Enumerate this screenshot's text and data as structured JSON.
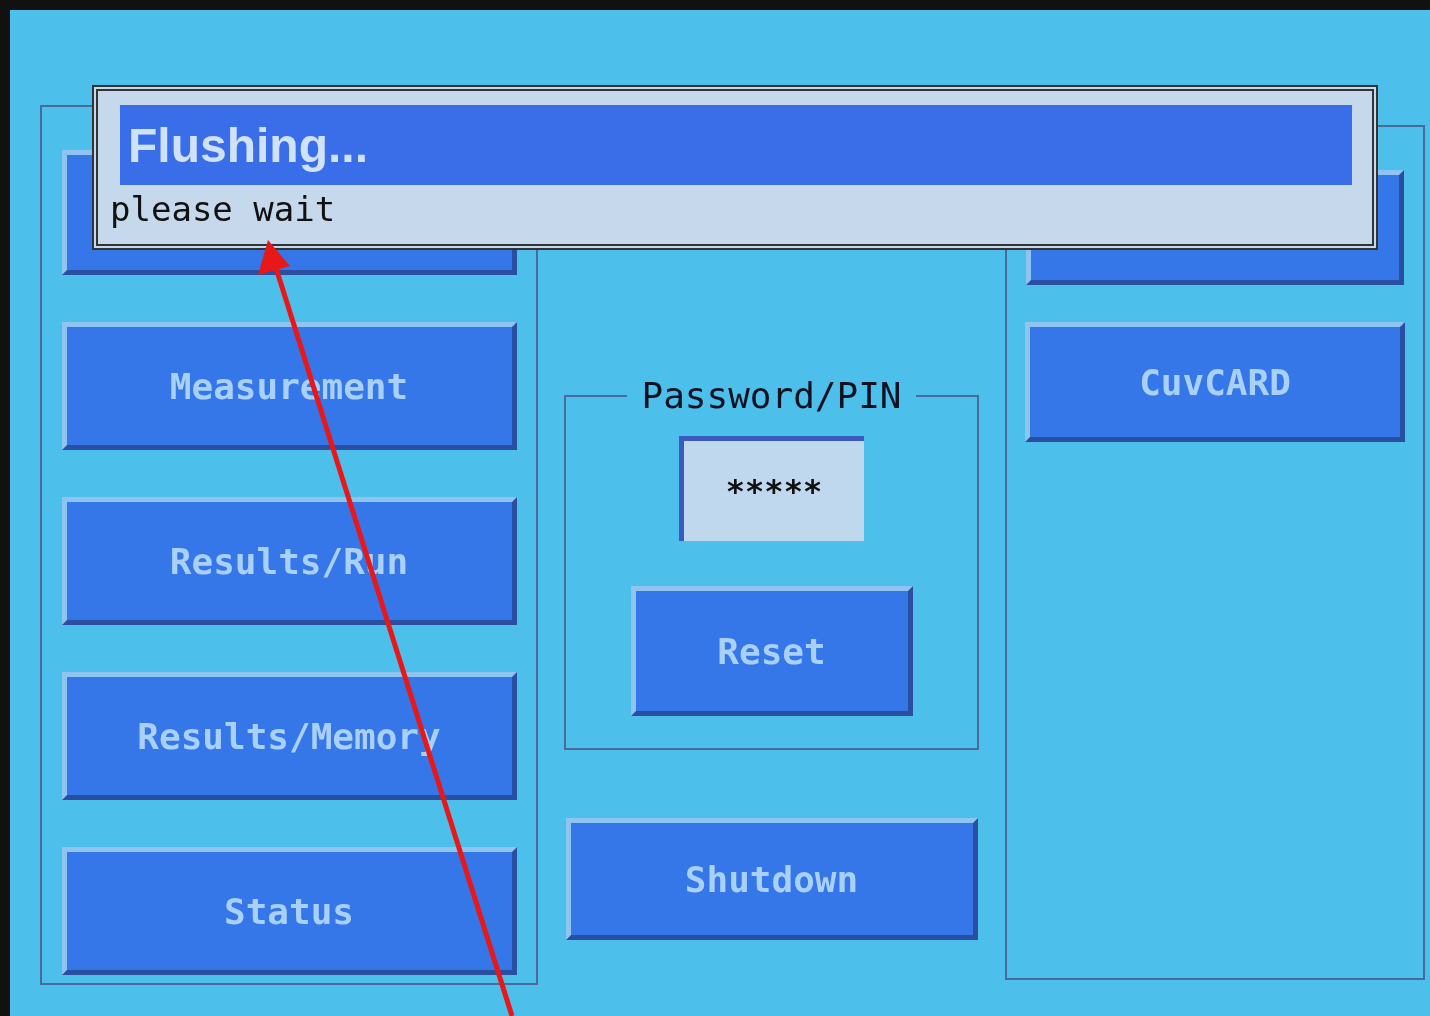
{
  "dialog": {
    "title": "Flushing...",
    "message": "please wait"
  },
  "left_menu": [
    "Measurement",
    "Results/Run",
    "Results/Memory",
    "Status"
  ],
  "password": {
    "label": "Password/PIN",
    "value": "*****"
  },
  "reset_button": "Reset",
  "shutdown_button": "Shutdown",
  "right_menu": [
    "CuvCARD"
  ]
}
